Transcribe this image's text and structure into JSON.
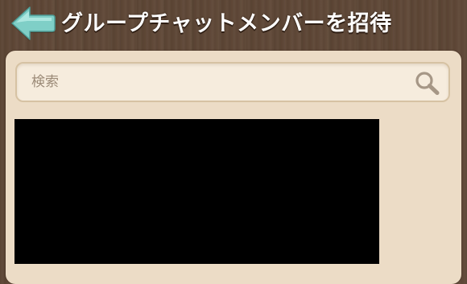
{
  "header": {
    "title": "グループチャットメンバーを招待",
    "back_icon": "back-arrow-icon"
  },
  "search": {
    "placeholder": "検索",
    "icon": "search-icon"
  },
  "colors": {
    "background": "#5e4736",
    "panel": "#ecdcc6",
    "search_field": "#f6ecdd",
    "back_arrow": "#7fcfc7",
    "title_text": "#ffffff",
    "redacted": "#000000"
  }
}
